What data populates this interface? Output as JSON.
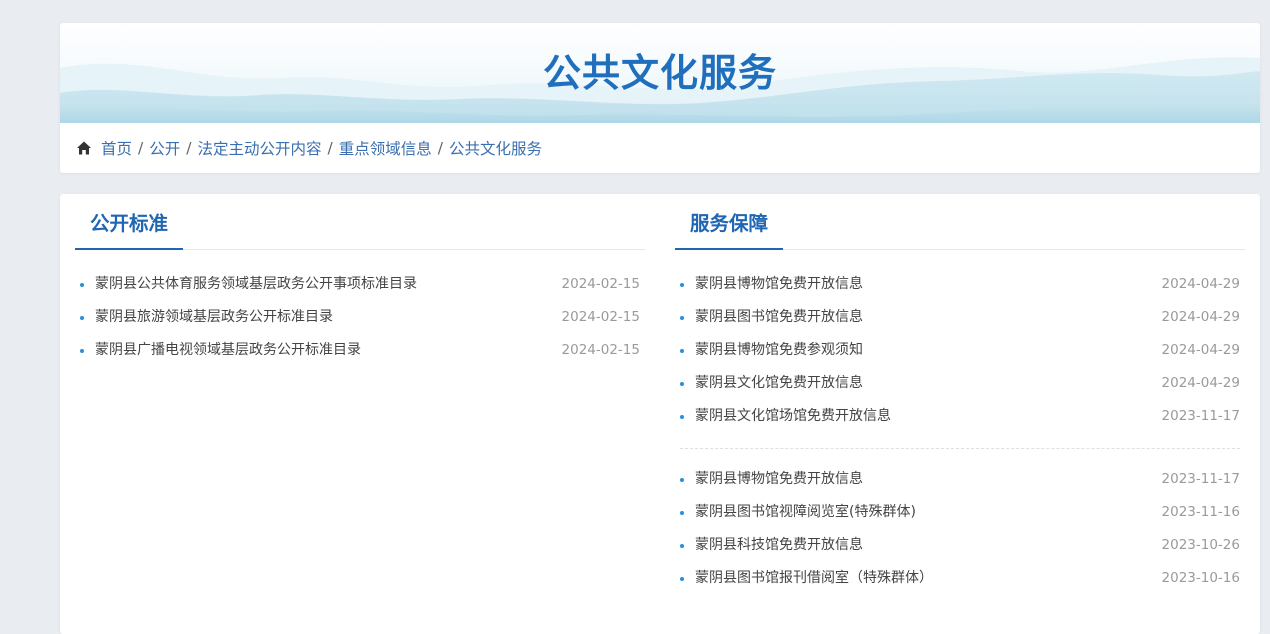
{
  "header": {
    "title": "公共文化服务"
  },
  "breadcrumb": {
    "items": [
      "首页",
      "公开",
      "法定主动公开内容",
      "重点领域信息",
      "公共文化服务"
    ],
    "separator": "/"
  },
  "sections": {
    "left": {
      "heading": "公开标准",
      "items": [
        {
          "title": "蒙阴县公共体育服务领域基层政务公开事项标准目录",
          "date": "2024-02-15"
        },
        {
          "title": "蒙阴县旅游领域基层政务公开标准目录",
          "date": "2024-02-15"
        },
        {
          "title": "蒙阴县广播电视领域基层政务公开标准目录",
          "date": "2024-02-15"
        }
      ]
    },
    "right": {
      "heading": "服务保障",
      "items_group1": [
        {
          "title": "蒙阴县博物馆免费开放信息",
          "date": "2024-04-29"
        },
        {
          "title": "蒙阴县图书馆免费开放信息",
          "date": "2024-04-29"
        },
        {
          "title": "蒙阴县博物馆免费参观须知",
          "date": "2024-04-29"
        },
        {
          "title": "蒙阴县文化馆免费开放信息",
          "date": "2024-04-29"
        },
        {
          "title": "蒙阴县文化馆场馆免费开放信息",
          "date": "2023-11-17"
        }
      ],
      "items_group2": [
        {
          "title": "蒙阴县博物馆免费开放信息",
          "date": "2023-11-17"
        },
        {
          "title": "蒙阴县图书馆视障阅览室(特殊群体)",
          "date": "2023-11-16"
        },
        {
          "title": "蒙阴县科技馆免费开放信息",
          "date": "2023-10-26"
        },
        {
          "title": "蒙阴县图书馆报刊借阅室（特殊群体）",
          "date": "2023-10-16"
        }
      ]
    }
  },
  "colors": {
    "accent": "#1f66b3",
    "title": "#1f6fbd",
    "bullet": "#2c8fd8",
    "date": "#9a9a9a",
    "background": "#e9edf1"
  },
  "icons": {
    "home": "home-icon"
  }
}
